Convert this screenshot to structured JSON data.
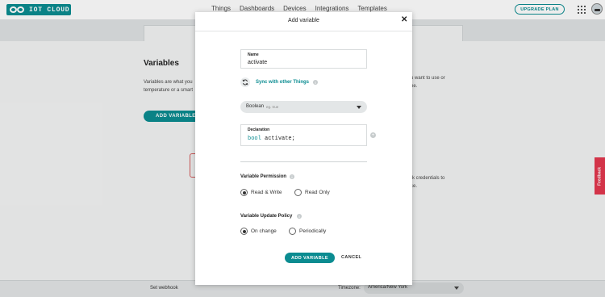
{
  "brand": {
    "name": "IOT CLOUD",
    "color": "#0b8c91"
  },
  "nav": {
    "items": [
      "Things",
      "Dashboards",
      "Devices",
      "Integrations",
      "Templates"
    ]
  },
  "header": {
    "upgrade_label": "UPGRADE PLAN",
    "apps_icon": "grid-icon",
    "avatar_icon": "user-avatar-icon"
  },
  "page": {
    "title": "Variables",
    "desc_line1": "Variables are what you",
    "desc_line2": "temperature or a smart",
    "right_line1": "u want to use or",
    "right_line2": "ne.",
    "right_line3": "rk credentials to",
    "right_line4": "ce.",
    "add_label": "ADD VARIABLE"
  },
  "footer": {
    "webhook_label": "Set webhook",
    "timezone_label": "Timezone:",
    "timezone_value": "America/New York"
  },
  "feedback_label": "Feedback",
  "modal": {
    "title": "Add variable",
    "close_icon": "close-icon",
    "name": {
      "label": "Name",
      "value": "activate"
    },
    "sync": {
      "label": "Sync with other Things",
      "icon": "sync-icon",
      "info": "i"
    },
    "type": {
      "value": "Boolean",
      "hint": "eg. true"
    },
    "declaration": {
      "label": "Declaration",
      "keyword": "bool",
      "identifier": "activate;"
    },
    "add_declaration": "+",
    "permission": {
      "title": "Variable Permission",
      "info": "i",
      "options": [
        "Read & Write",
        "Read Only"
      ],
      "selected": "Read & Write"
    },
    "policy": {
      "title": "Variable Update Policy",
      "info": "i",
      "options": [
        "On change",
        "Periodically"
      ],
      "selected": "On change"
    },
    "primary_label": "ADD VARIABLE",
    "cancel_label": "CANCEL"
  }
}
